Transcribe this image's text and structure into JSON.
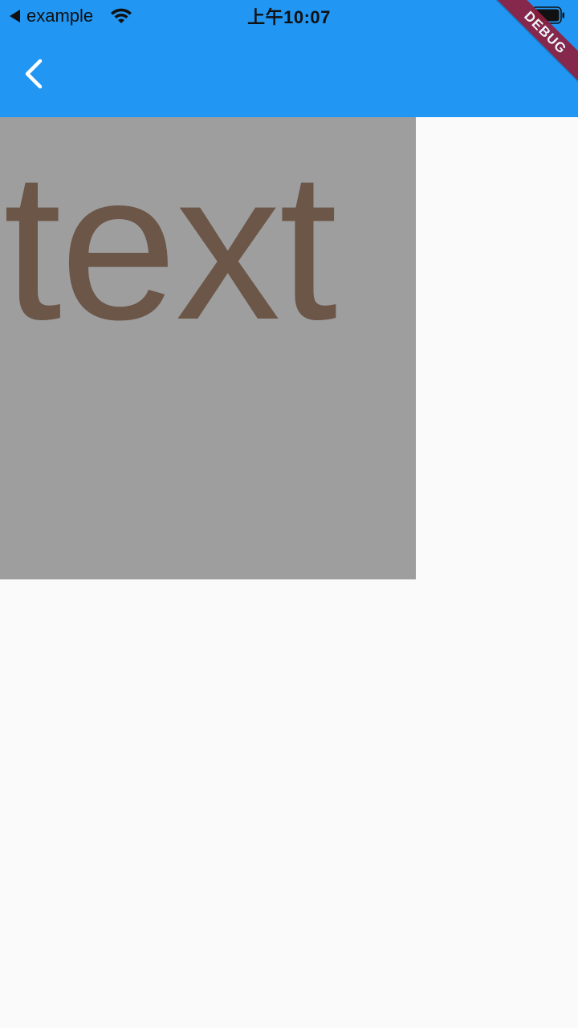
{
  "status_bar": {
    "back_app_label": "example",
    "time": "上午10:07"
  },
  "app_bar": {
    "background_color": "#2196f3",
    "back_icon": "chevron-left-icon"
  },
  "debug_banner": {
    "label": "DEBUG",
    "color": "#8e1f3e"
  },
  "content": {
    "box_color": "#9e9e9e",
    "text": "text",
    "text_color": "#6b5648"
  }
}
